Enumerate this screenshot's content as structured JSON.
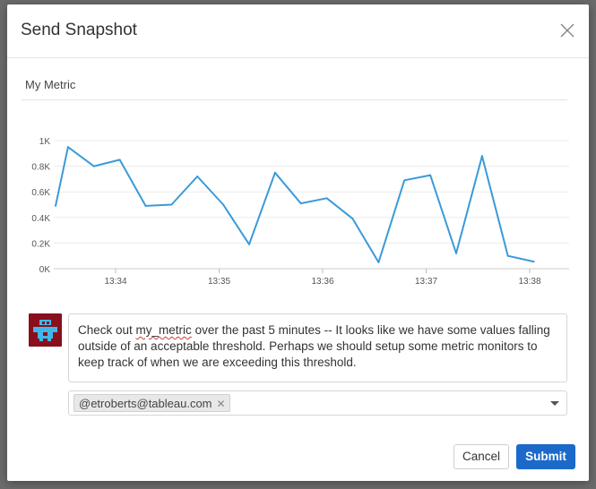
{
  "dialog": {
    "title": "Send Snapshot",
    "close_icon": "close-icon"
  },
  "snapshot": {
    "metric_name": "My Metric"
  },
  "chart_data": {
    "type": "line",
    "title": "",
    "xlabel": "",
    "ylabel": "",
    "x_tick_labels": [
      "13:34",
      "13:35",
      "13:36",
      "13:37",
      "13:38"
    ],
    "y_tick_labels": [
      "0K",
      "0.2K",
      "0.4K",
      "0.6K",
      "0.8K",
      "1K"
    ],
    "ylim": [
      0,
      1000
    ],
    "x_unit": "minutes after 13:34",
    "x": [
      -0.58,
      -0.46,
      -0.21,
      0.04,
      0.29,
      0.54,
      0.79,
      1.04,
      1.29,
      1.54,
      1.79,
      2.04,
      2.29,
      2.54,
      2.79,
      3.04,
      3.29,
      3.54,
      3.79,
      4.04
    ],
    "series": [
      {
        "values": [
          490,
          950,
          800,
          850,
          490,
          500,
          720,
          500,
          190,
          750,
          510,
          550,
          390,
          50,
          690,
          730,
          120,
          880,
          100,
          55
        ],
        "color": "#3a9ad9"
      }
    ],
    "grid": true,
    "legend": "none"
  },
  "comment": {
    "text_before": "Check out ",
    "misspelled_word": "my_metric",
    "text_after": " over the past 5 minutes -- It looks like we have some values falling outside of an acceptable threshold.  Perhaps we should setup some metric monitors to keep track of when we are exceeding this threshold."
  },
  "recipients": {
    "selected": [
      "@etroberts@tableau.com"
    ],
    "remove_symbol": "✕"
  },
  "buttons": {
    "cancel_label": "Cancel",
    "submit_label": "Submit"
  },
  "colors": {
    "accent": "#1b6ac9",
    "line": "#3a9ad9",
    "avatar_bg": "#8a0f1c",
    "avatar_fg": "#3fb8e8"
  },
  "avatar": {
    "icon": "user-avatar-identicon"
  }
}
